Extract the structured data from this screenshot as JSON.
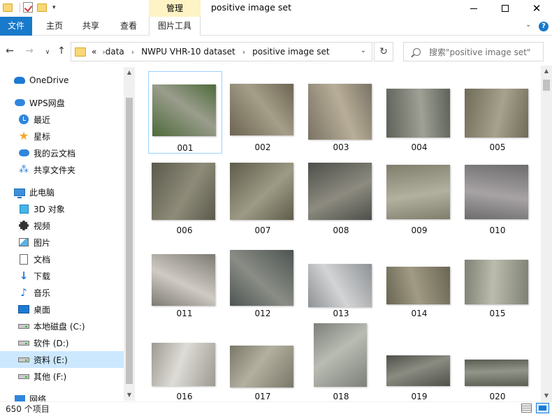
{
  "window": {
    "title": "positive image set",
    "manage_tab": "管理"
  },
  "ribbon": {
    "tabs": {
      "file": "文件",
      "home": "主页",
      "share": "共享",
      "view": "查看",
      "picture_tools": "图片工具"
    },
    "help": "?"
  },
  "address": {
    "overflow": "«",
    "breadcrumbs": [
      "data",
      "NWPU VHR-10 dataset",
      "positive image set"
    ],
    "separator": "›"
  },
  "search": {
    "placeholder": "搜索\"positive image set\""
  },
  "nav": {
    "items": [
      {
        "label": "OneDrive",
        "icon": "onedrive-cloud-icon"
      },
      {
        "label": "WPS网盘",
        "icon": "wps-cloud-icon"
      },
      {
        "label": "最近",
        "icon": "recent-clock-icon"
      },
      {
        "label": "星标",
        "icon": "star-icon"
      },
      {
        "label": "我的云文档",
        "icon": "cloud-docs-icon"
      },
      {
        "label": "共享文件夹",
        "icon": "shared-folder-icon"
      },
      {
        "label": "此电脑",
        "icon": "this-pc-icon"
      },
      {
        "label": "3D 对象",
        "icon": "3d-objects-icon"
      },
      {
        "label": "视频",
        "icon": "videos-icon"
      },
      {
        "label": "图片",
        "icon": "pictures-icon"
      },
      {
        "label": "文档",
        "icon": "documents-icon"
      },
      {
        "label": "下载",
        "icon": "downloads-icon"
      },
      {
        "label": "音乐",
        "icon": "music-icon"
      },
      {
        "label": "桌面",
        "icon": "desktop-icon"
      },
      {
        "label": "本地磁盘 (C:)",
        "icon": "drive-icon"
      },
      {
        "label": "软件 (D:)",
        "icon": "drive-icon"
      },
      {
        "label": "资料 (E:)",
        "icon": "drive-icon"
      },
      {
        "label": "其他 (F:)",
        "icon": "drive-icon"
      },
      {
        "label": "网络",
        "icon": "network-icon"
      }
    ],
    "selected": "资料 (E:)"
  },
  "files": [
    {
      "name": "001",
      "colors": [
        "#4f6a3c",
        "#9a9d8c"
      ]
    },
    {
      "name": "002",
      "colors": [
        "#6d6552",
        "#a59e88"
      ]
    },
    {
      "name": "003",
      "colors": [
        "#7a7365",
        "#b8ae98"
      ]
    },
    {
      "name": "004",
      "colors": [
        "#5e6258",
        "#9fa096"
      ]
    },
    {
      "name": "005",
      "colors": [
        "#6f6b58",
        "#a6a28d"
      ]
    },
    {
      "name": "006",
      "colors": [
        "#5b5a4b",
        "#8e8b79"
      ]
    },
    {
      "name": "007",
      "colors": [
        "#5f5c4b",
        "#9d9a85"
      ]
    },
    {
      "name": "008",
      "colors": [
        "#4d4f4a",
        "#8d8b80"
      ]
    },
    {
      "name": "009",
      "colors": [
        "#7f7e6c",
        "#b2b09e"
      ]
    },
    {
      "name": "010",
      "colors": [
        "#6e6c6c",
        "#a7a3a4"
      ]
    },
    {
      "name": "011",
      "colors": [
        "#7d7a74",
        "#cfcac3"
      ]
    },
    {
      "name": "012",
      "colors": [
        "#4e5552",
        "#8a8d86"
      ]
    },
    {
      "name": "013",
      "colors": [
        "#8f9294",
        "#d2d4d6"
      ]
    },
    {
      "name": "014",
      "colors": [
        "#6a6652",
        "#a19b85"
      ]
    },
    {
      "name": "015",
      "colors": [
        "#7f8174",
        "#bbbcae"
      ]
    },
    {
      "name": "016",
      "colors": [
        "#9c9a92",
        "#dedcd6"
      ]
    },
    {
      "name": "017",
      "colors": [
        "#7a7768",
        "#b4b0a0"
      ]
    },
    {
      "name": "018",
      "colors": [
        "#7d8079",
        "#b9bcb3"
      ]
    },
    {
      "name": "019",
      "colors": [
        "#4f514a",
        "#8a8c82"
      ]
    },
    {
      "name": "020",
      "colors": [
        "#5b5e52",
        "#92958a"
      ]
    }
  ],
  "status": {
    "item_count": "650 个项目"
  },
  "colors": {
    "accent": "#1979ca",
    "selection": "#cce8ff",
    "manage_highlight": "#fdf3c4"
  }
}
